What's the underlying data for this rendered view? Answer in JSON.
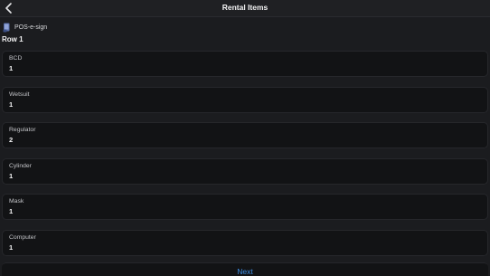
{
  "header": {
    "title": "Rental Items",
    "back_icon": "chevron-left-icon"
  },
  "source": {
    "icon": "document-app-icon",
    "label": "POS-e-sign"
  },
  "row_heading": "Row 1",
  "fields": [
    {
      "label": "BCD",
      "value": "1"
    },
    {
      "label": "Wetsuit",
      "value": "1"
    },
    {
      "label": "Regulator",
      "value": "2"
    },
    {
      "label": "Cylinder",
      "value": "1"
    },
    {
      "label": "Mask",
      "value": "1"
    },
    {
      "label": "Computer",
      "value": "1"
    }
  ],
  "footer": {
    "next_label": "Next"
  },
  "colors": {
    "background": "#1b1c1f",
    "field_background": "#121315",
    "accent": "#3f8fe6"
  }
}
